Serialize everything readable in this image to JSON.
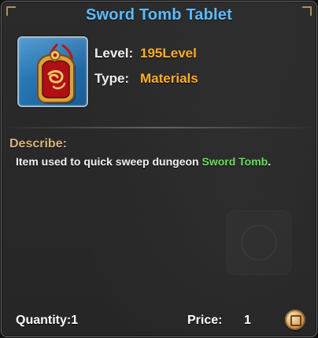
{
  "tooltip": {
    "title": "Sword Tomb Tablet",
    "item": {
      "icon": "sword-tomb-tablet-icon",
      "level_label": "Level:",
      "level_value": "195Level",
      "type_label": "Type:",
      "type_value": "Materials"
    },
    "describe": {
      "label": "Describe:",
      "prefix": "Item used to quick sweep dungeon ",
      "highlight": "Sword Tomb",
      "suffix": "."
    },
    "footer": {
      "quantity_label": "Quantity:",
      "quantity_value": "1",
      "price_label": "Price:",
      "price_value": "1",
      "currency_icon": "coin-icon"
    }
  },
  "colors": {
    "title": "#5bbcff",
    "value_accent": "#ffad2a",
    "describe_label": "#d7b27c",
    "highlight": "#66e05b",
    "panel_bg": "#262626",
    "panel_border": "#6a6a6a"
  }
}
